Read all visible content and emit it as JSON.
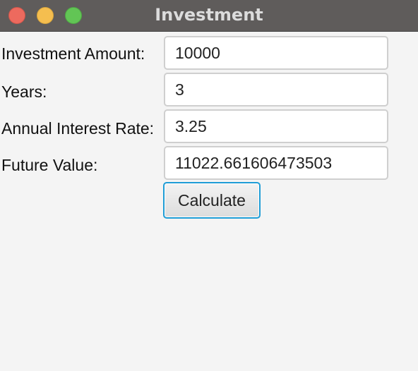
{
  "window": {
    "title": "Investment"
  },
  "form": {
    "investment_amount": {
      "label": "Investment Amount:",
      "value": "10000"
    },
    "years": {
      "label": "Years:",
      "value": "3"
    },
    "annual_interest_rate": {
      "label": "Annual Interest Rate:",
      "value": "3.25"
    },
    "future_value": {
      "label": "Future Value:",
      "value": "11022.661606473503"
    }
  },
  "actions": {
    "calculate_label": "Calculate"
  },
  "colors": {
    "titlebar": "#5f5c5b",
    "window_background": "#f4f4f4",
    "close": "#ed6a5e",
    "minimize": "#f5be4f",
    "zoom": "#62c555",
    "focus_ring": "#1f9dd6"
  },
  "icons": {
    "close": "close-icon",
    "minimize": "minimize-icon",
    "zoom": "zoom-icon"
  }
}
